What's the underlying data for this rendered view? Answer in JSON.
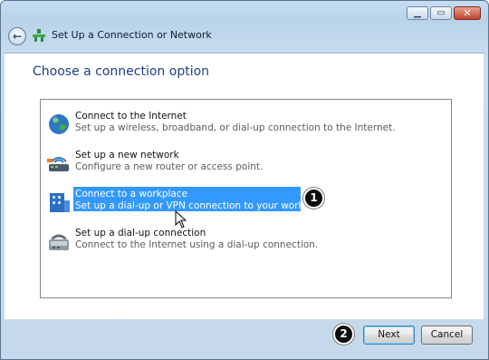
{
  "window": {
    "title": "Set Up a Connection or Network",
    "controls": {
      "minimize": "minimize",
      "maximize": "maximize",
      "close": "close"
    }
  },
  "heading": "Choose a connection option",
  "options": [
    {
      "title": "Connect to the Internet",
      "desc": "Set up a wireless, broadband, or dial-up connection to the Internet.",
      "icon": "globe-icon",
      "selected": false
    },
    {
      "title": "Set up a new network",
      "desc": "Configure a new router or access point.",
      "icon": "router-icon",
      "selected": false
    },
    {
      "title": "Connect to a workplace",
      "desc": "Set up a dial-up or VPN connection to your workplace.",
      "icon": "workplace-icon",
      "selected": true
    },
    {
      "title": "Set up a dial-up connection",
      "desc": "Connect to the Internet using a dial-up connection.",
      "icon": "modem-icon",
      "selected": false
    }
  ],
  "annotations": {
    "badge1": "1",
    "badge2": "2"
  },
  "buttons": {
    "next": "Next",
    "cancel": "Cancel"
  },
  "colors": {
    "selection": "#3399ff",
    "heading": "#1f3d86",
    "frame": "#c4dcf0"
  }
}
